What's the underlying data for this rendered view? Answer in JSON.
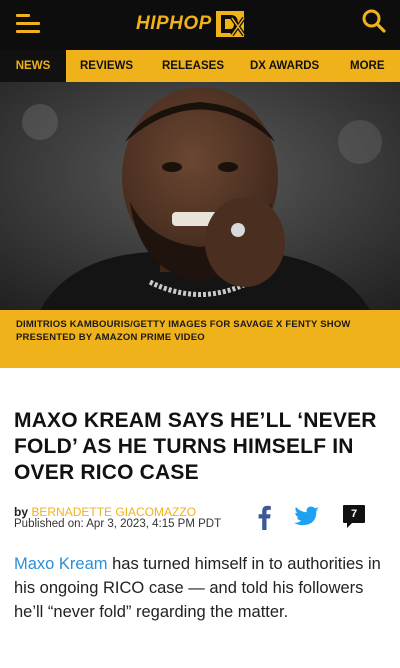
{
  "header": {
    "logo_text": "HIPHOP",
    "logo_mark": "DX",
    "menu_icon": "hamburger-menu-icon",
    "search_icon": "search-icon"
  },
  "nav": {
    "items": [
      "NEWS",
      "REVIEWS",
      "RELEASES",
      "DX AWARDS",
      "MORE"
    ],
    "active": "NEWS"
  },
  "hero": {
    "caption": "DIMITRIOS KAMBOURIS/GETTY IMAGES FOR SAVAGE X FENTY SHOW PRESENTED BY AMAZON PRIME VIDEO"
  },
  "article": {
    "headline": "MAXO KREAM SAYS HE’LL ‘NEVER FOLD’ AS HE TURNS HIMSELF IN OVER RICO CASE",
    "by_label": "by",
    "author": "BERNADETTE GIACOMAZZO",
    "published": "Published on: Apr 3, 2023, 4:15 PM PDT",
    "comment_count": "7",
    "body_link": "Maxo Kream",
    "body_rest": " has turned himself in to authorities in his ongoing RICO case — and told his followers he’ll “never fold” regarding the matter."
  },
  "colors": {
    "brand_gold": "#f0b21a",
    "header_bg": "#0d0d0d",
    "link_blue": "#2a8fd8",
    "facebook": "#3b5998",
    "twitter": "#1da1f2"
  }
}
